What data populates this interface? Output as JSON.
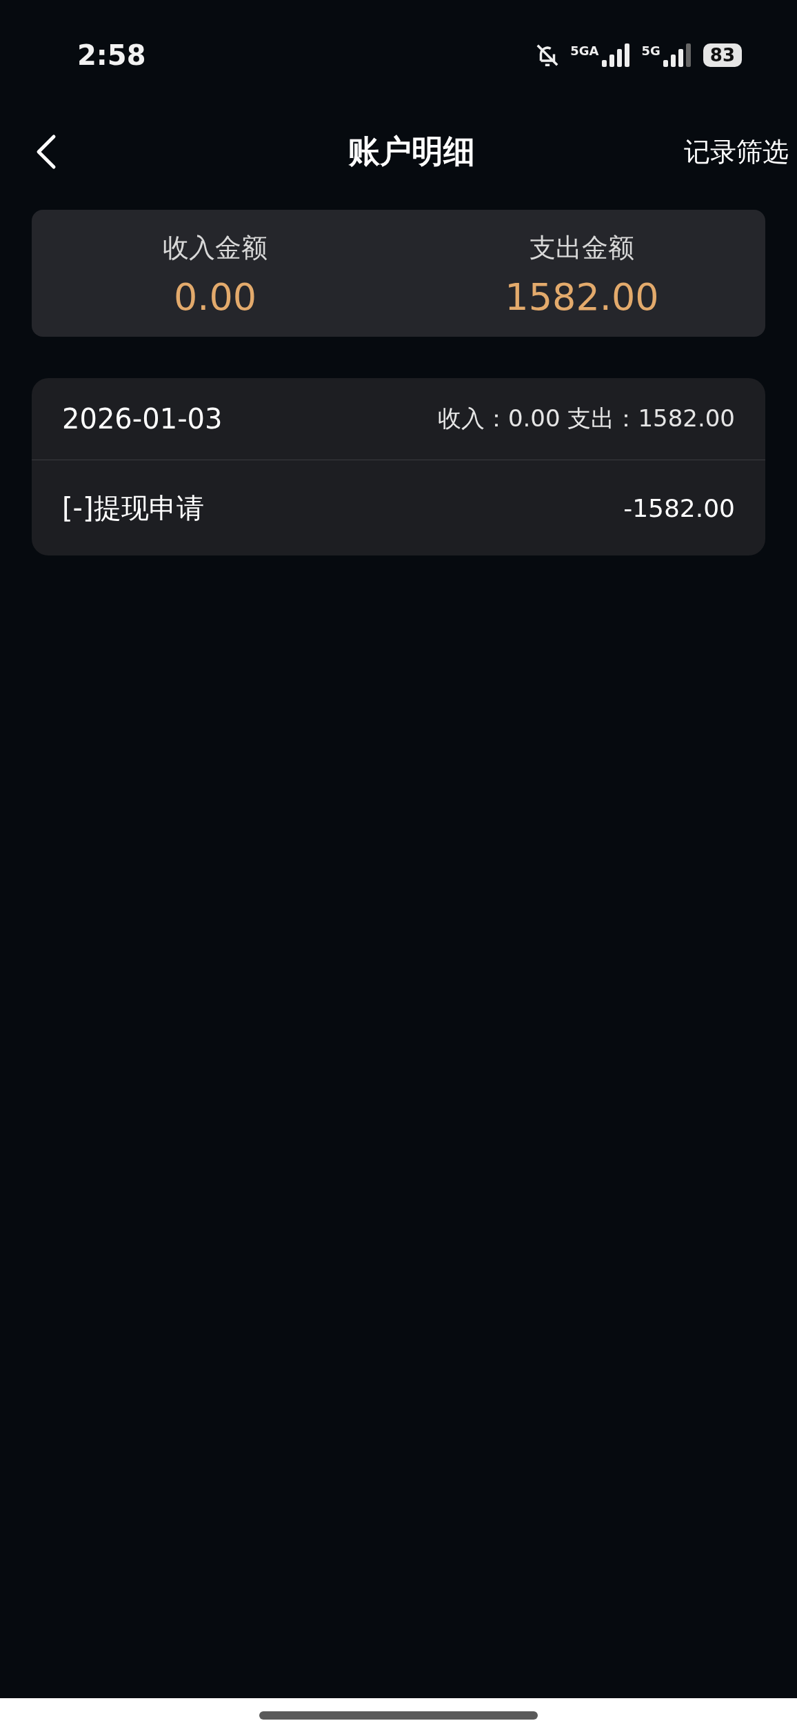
{
  "status_bar": {
    "time": "2:58",
    "networks": [
      "5GA",
      "5G"
    ],
    "battery": "83"
  },
  "header": {
    "title": "账户明细",
    "action": "记录筛选"
  },
  "summary": [
    {
      "label": "收入金额",
      "amount": "0.00"
    },
    {
      "label": "支出金额",
      "amount": "1582.00"
    }
  ],
  "records": [
    {
      "date": "2026-01-03",
      "totals": "收入：0.00 支出：1582.00",
      "entries": [
        {
          "title": "[-]提现申请",
          "amount": "-1582.00"
        }
      ]
    }
  ]
}
